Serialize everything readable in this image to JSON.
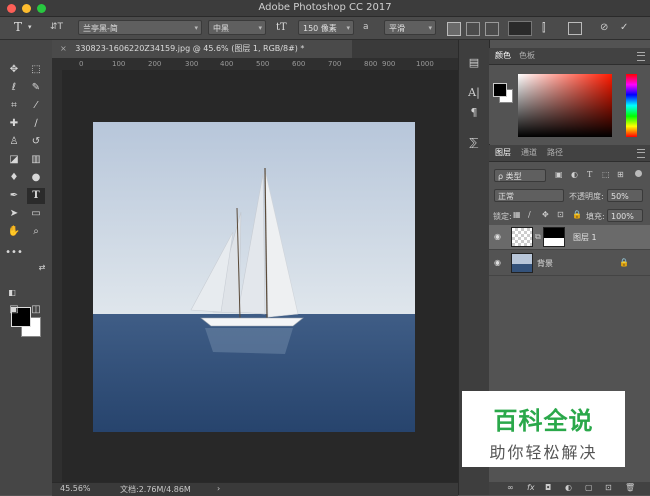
{
  "window": {
    "title": "Adobe Photoshop CC 2017"
  },
  "options_bar": {
    "tool_glyph": "T",
    "orient_glyph": "⇵T",
    "font_family": "兰亭黑-简",
    "font_style": "中黑",
    "size_glyph": "tT",
    "font_size": "150 像素",
    "aa_label": "a",
    "anti_alias": "平滑"
  },
  "document": {
    "tab_label": "330823-1606220Z34159.jpg @ 45.6% (图层 1, RGB/8#) *",
    "close_glyph": "×",
    "ruler_ticks": [
      "0",
      "100",
      "200",
      "300",
      "400",
      "500",
      "600",
      "700",
      "800",
      "900",
      "1000"
    ],
    "image_description": "white sailboat on blue sea"
  },
  "status": {
    "zoom": "45.56%",
    "doc_size": "文档:2.76M/4.86M",
    "arrow": "›"
  },
  "color_panel": {
    "tabs": [
      "颜色",
      "色板"
    ],
    "active": "颜色"
  },
  "layers_panel": {
    "tabs": [
      "图层",
      "通道",
      "路径"
    ],
    "filter": "ρ 类型",
    "blend_mode": "正常",
    "opacity_label": "不透明度:",
    "opacity_value": "50%",
    "lock_label": "锁定:",
    "fill_label": "填充:",
    "fill_value": "100%",
    "layers": [
      {
        "name": "图层 1",
        "selected": true
      },
      {
        "name": "背景",
        "selected": false
      }
    ]
  },
  "watermark": {
    "title": "百科全说",
    "subtitle": "助你轻松解决"
  },
  "bottom_icons": [
    "∞",
    "fx",
    "◘",
    "◐",
    "▢",
    "⊡",
    "🗑"
  ]
}
